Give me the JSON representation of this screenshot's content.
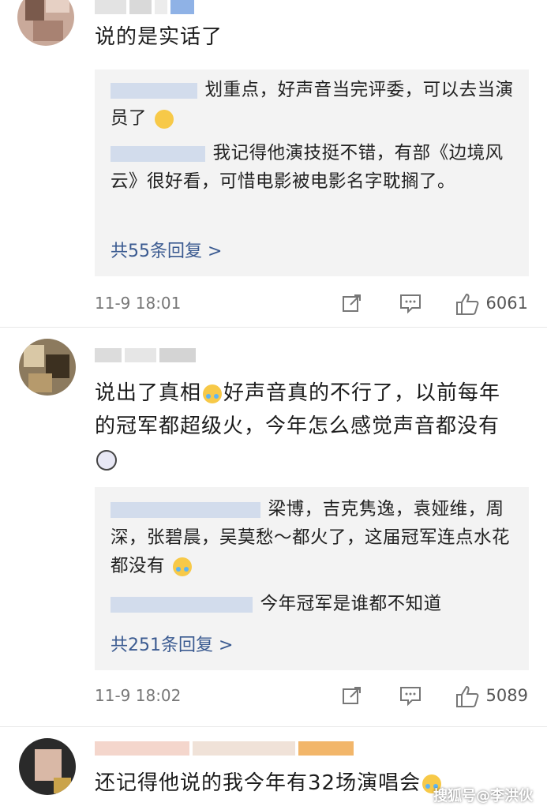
{
  "comments": [
    {
      "text": "说的是实话了",
      "replies": [
        {
          "text": "划重点，好声音当完评委，可以去当演员了",
          "emoji": "glasses-emoji"
        },
        {
          "text": "我记得他演技挺不错，有部《边境风云》很好看，可惜电影被电影名字耽搁了。"
        }
      ],
      "more": "共55条回复 >",
      "time": "11-9 18:01",
      "likes": "6061"
    },
    {
      "text": "说出了真相😂好声音真的不行了，以前每年的冠军都超级火，今年怎么感觉声音都没有😱",
      "text_parts": [
        "说出了真相",
        "好声音真的不行了，以前每年的冠军都超级火，今年怎么感觉声音都没有"
      ],
      "replies": [
        {
          "text": "梁博，吉克隽逸，袁娅维，周深，张碧晨，吴莫愁～都火了，这届冠军连点水花都没有"
        },
        {
          "text": "今年冠军是谁都不知道"
        }
      ],
      "more": "共251条回复 >",
      "time": "11-9 18:02",
      "likes": "5089"
    },
    {
      "text": "还记得他说的我今年有32场演唱会"
    }
  ],
  "watermark": "搜狐号@李洪伙",
  "colors": {
    "link": "#3a5a90",
    "reply_bg": "#f3f3f3",
    "meta": "#777777"
  },
  "icons": [
    "share-icon",
    "comment-icon",
    "like-icon"
  ]
}
